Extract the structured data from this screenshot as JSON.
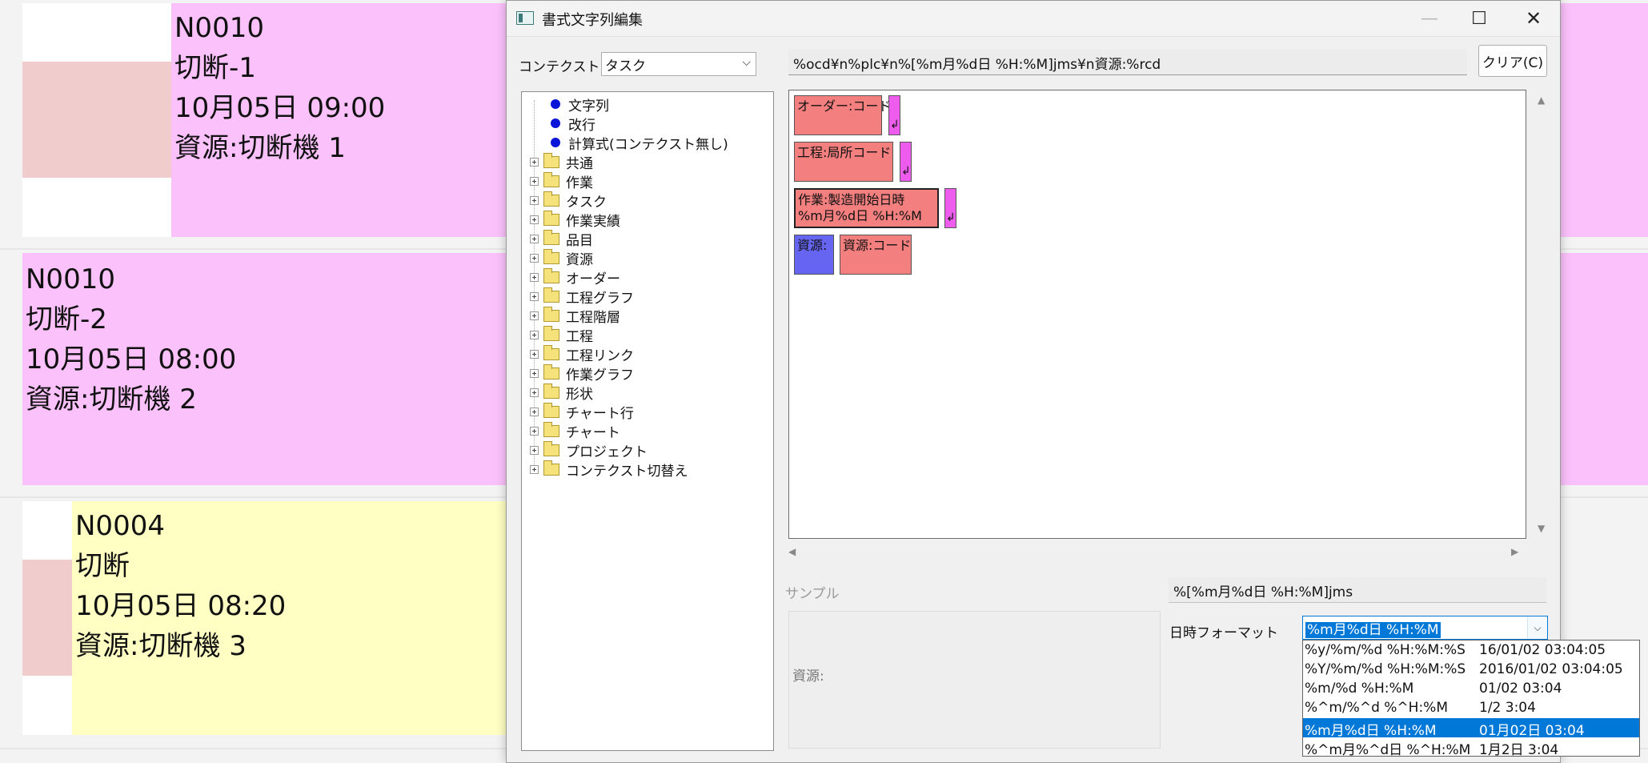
{
  "background_cards": [
    {
      "lines": [
        "N0010",
        "切断-1",
        "10月05日 09:00",
        "資源:切断機 1"
      ],
      "color": "#fbc1fb"
    },
    {
      "lines": [
        "N0010",
        "切断-2",
        "10月05日 08:00",
        "資源:切断機 2"
      ],
      "color": "#fbc1fb"
    },
    {
      "lines": [
        "N0004",
        "切断",
        "10月05日 08:20",
        "資源:切断機 3"
      ],
      "color": "#ffffc3"
    }
  ],
  "dialog": {
    "title": "書式文字列編集",
    "minimize_glyph": "—",
    "maximize_glyph": "☐",
    "close_glyph": "✕",
    "context_label": "コンテクスト",
    "context_value": "タスク",
    "formula": "%ocd¥n%plc¥n%[%m月%d日 %H:%M]jms¥n資源:%rcd",
    "clear_button": "クリア(C)",
    "tree": {
      "leaf_items": [
        "文字列",
        "改行",
        "計算式(コンテクスト無し)"
      ],
      "folder_items": [
        "共通",
        "作業",
        "タスク",
        "作業実績",
        "品目",
        "資源",
        "オーダー",
        "工程グラフ",
        "工程階層",
        "工程",
        "工程リンク",
        "作業グラフ",
        "形状",
        "チャート行",
        "チャート",
        "プロジェクト",
        "コンテクスト切替え"
      ]
    },
    "tokens": {
      "order_code": "オーダー:コード",
      "process_code": "工程:局所コード",
      "start_line1": "作業:製造開始日時",
      "start_line2": "%m月%d日 %H:%M",
      "resource_literal": "資源:",
      "resource_code": "資源:コード"
    },
    "sample_label": "サンプル",
    "sample_preview": "資源:",
    "sample_format": "%[%m月%d日 %H:%M]jms",
    "datetime_label": "日時フォーマット",
    "datetime_value": "%m月%d日 %H:%M",
    "datetime_options": [
      {
        "format": "%y/%m/%d %H:%M:%S",
        "example": "16/01/02 03:04:05"
      },
      {
        "format": "%Y/%m/%d %H:%M:%S",
        "example": "2016/01/02 03:04:05"
      },
      {
        "format": "%m/%d %H:%M",
        "example": "01/02 03:04"
      },
      {
        "format": "%^m/%^d %^H:%M",
        "example": "1/2 3:04"
      },
      {
        "format": "%m月%d日 %H:%M",
        "example": "01月02日 03:04",
        "selected": true
      },
      {
        "format": "%^m月%^d日 %^H:%M",
        "example": "1月2日 3:04"
      }
    ]
  }
}
